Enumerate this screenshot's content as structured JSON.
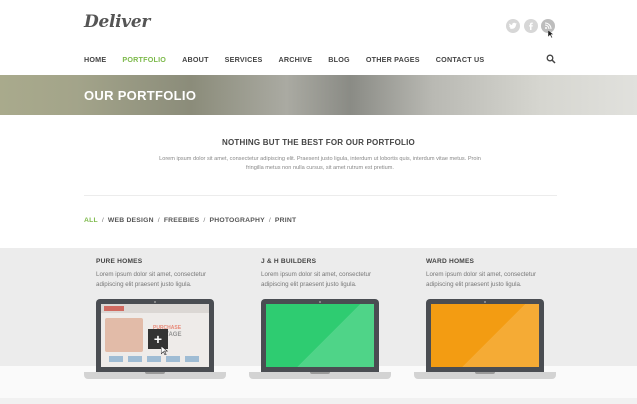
{
  "header": {
    "logo": "Deliver",
    "social_icons": [
      "twitter-icon",
      "facebook-icon",
      "rss-icon"
    ]
  },
  "nav": {
    "items": [
      {
        "label": "HOME",
        "active": false
      },
      {
        "label": "PORTFOLIO",
        "active": true
      },
      {
        "label": "ABOUT",
        "active": false
      },
      {
        "label": "SERVICES",
        "active": false
      },
      {
        "label": "ARCHIVE",
        "active": false
      },
      {
        "label": "BLOG",
        "active": false
      },
      {
        "label": "OTHER PAGES",
        "active": false
      },
      {
        "label": "CONTACT US",
        "active": false
      }
    ]
  },
  "banner": {
    "title": "OUR PORTFOLIO"
  },
  "intro": {
    "title": "NOTHING BUT THE BEST FOR OUR PORTFOLIO",
    "text": "Lorem ipsum dolor sit amet, consectetur adipiscing elit. Praesent justo ligula, interdum ut lobortis quis, interdum vitae metus. Proin fringilla metus non nulla cursus, sit amet rutrum est pretium."
  },
  "filters": [
    {
      "label": "ALL",
      "active": true
    },
    {
      "label": "WEB DESIGN",
      "active": false
    },
    {
      "label": "FREEBIES",
      "active": false
    },
    {
      "label": "PHOTOGRAPHY",
      "active": false
    },
    {
      "label": "PRINT",
      "active": false
    }
  ],
  "portfolio": [
    {
      "title": "PURE HOMES",
      "desc": "Lorem ipsum dolor sit amet, consectetur adipiscing elit praesent justo ligula.",
      "screen": "website-preview"
    },
    {
      "title": "J & H BUILDERS",
      "desc": "Lorem ipsum dolor sit amet, consectetur adipiscing elit praesent justo ligula.",
      "screen": "green"
    },
    {
      "title": "WARD HOMES",
      "desc": "Lorem ipsum dolor sit amet, consectetur adipiscing elit praesent justo ligula.",
      "screen": "orange"
    }
  ],
  "preview": {
    "headline1": "PURCHASE",
    "headline2": "VANTAGE",
    "plus": "+"
  },
  "colors": {
    "accent": "#7dba4b",
    "green_screen": "#2ecc71",
    "orange_screen": "#f39c12"
  }
}
